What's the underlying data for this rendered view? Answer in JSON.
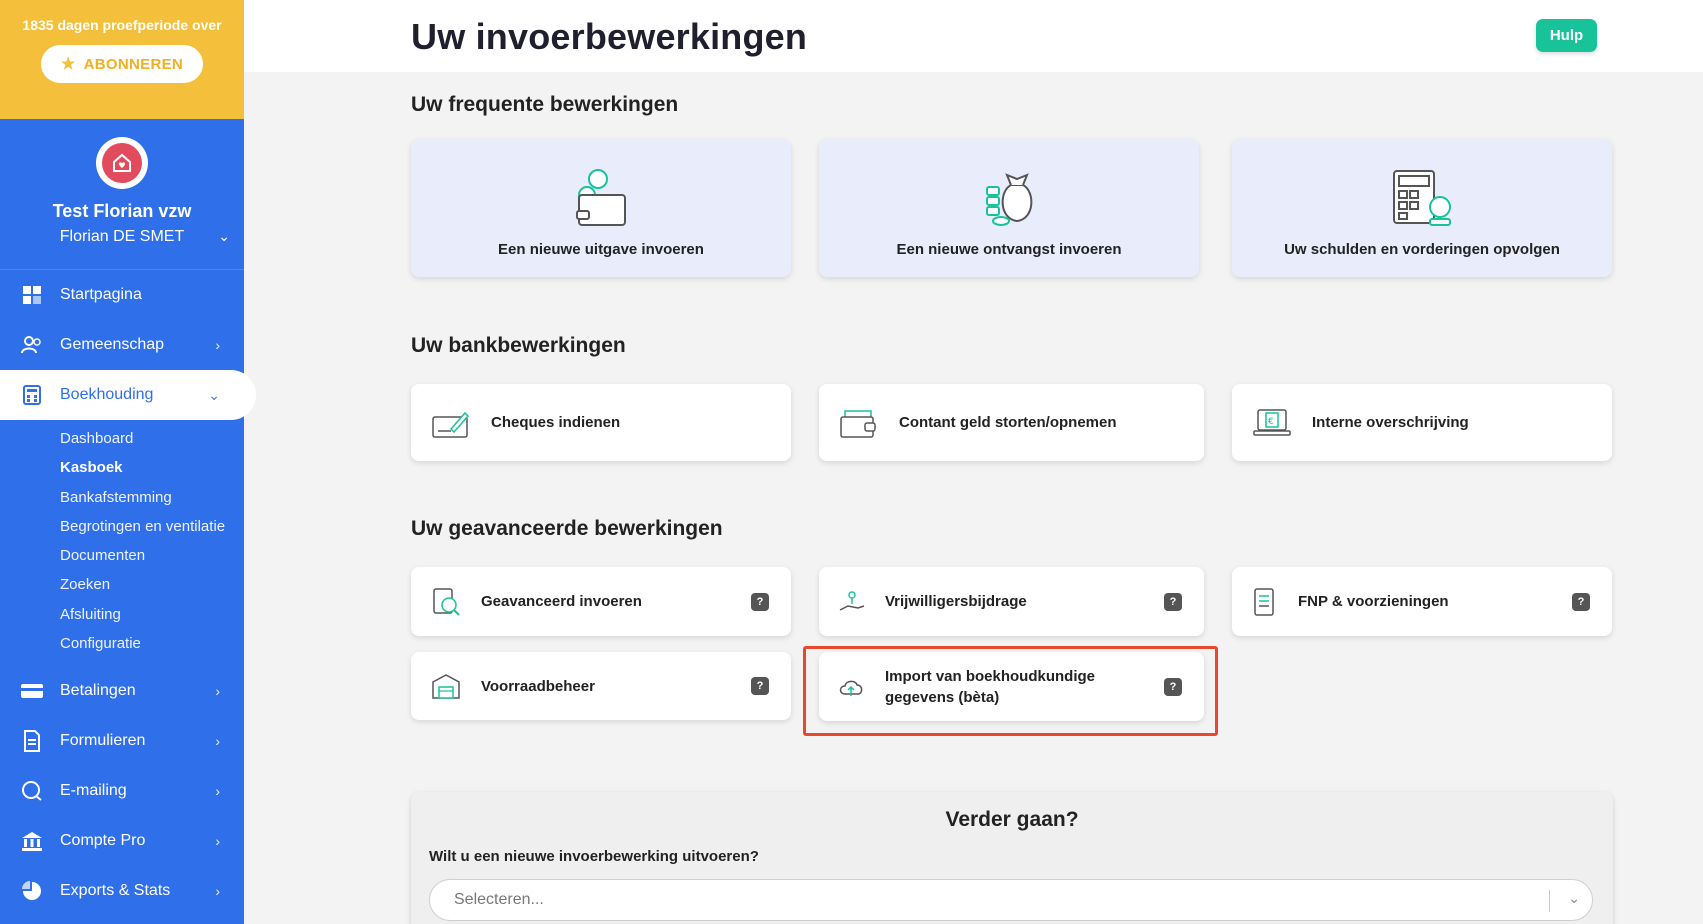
{
  "trial": {
    "text": "1835 dagen proefperiode over",
    "subscribe_label": "ABONNEREN"
  },
  "profile": {
    "org": "Test Florian vzw",
    "user": "Florian DE SMET"
  },
  "nav": {
    "startpagina": "Startpagina",
    "gemeenschap": "Gemeenschap",
    "boekhouding": "Boekhouding",
    "betalingen": "Betalingen",
    "formulieren": "Formulieren",
    "emailing": "E-mailing",
    "comptepro": "Compte Pro",
    "exports": "Exports & Stats"
  },
  "subnav": [
    "Dashboard",
    "Kasboek",
    "Bankafstemming",
    "Begrotingen en ventilatie",
    "Documenten",
    "Zoeken",
    "Afsluiting",
    "Configuratie"
  ],
  "header": {
    "title": "Uw invoerbewerkingen",
    "help": "Hulp"
  },
  "sections": {
    "frequent": "Uw frequente bewerkingen",
    "bank": "Uw bankbewerkingen",
    "advanced": "Uw geavanceerde bewerkingen"
  },
  "frequent": [
    "Een nieuwe uitgave invoeren",
    "Een nieuwe ontvangst invoeren",
    "Uw schulden en vorderingen opvolgen"
  ],
  "bank": [
    "Cheques indienen",
    "Contant geld storten/opnemen",
    "Interne overschrijving"
  ],
  "advanced": {
    "geavanceerd": "Geavanceerd invoeren",
    "vrijwilligers": "Vrijwilligersbijdrage",
    "fnp": "FNP & voorzieningen",
    "voorraad": "Voorraadbeheer",
    "import_line1": "Import van boekhoudkundige",
    "import_line2": "gegevens (bèta)",
    "qmark": "?"
  },
  "further": {
    "title": "Verder gaan?",
    "question": "Wilt u een nieuwe invoerbewerking uitvoeren?",
    "placeholder": "Selecteren..."
  },
  "colors": {
    "sidebar": "#2f6fea",
    "trial": "#f4bf3a",
    "help": "#19c39a",
    "highlight": "#e8492b",
    "icon_teal": "#19c39a"
  }
}
